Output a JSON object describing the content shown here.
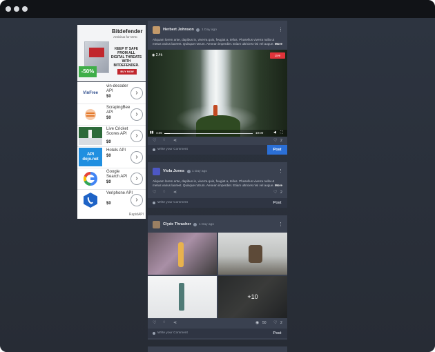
{
  "ads": {
    "banner": {
      "brand": "Bitdefender",
      "subtitle": "Antivirus for MAC",
      "tagline": "KEEP IT SAFE FROM ALL DIGITAL THREATS WITH BITDEFENDER.",
      "discount": "-50%",
      "cta": "BUY NOW"
    },
    "api_list": [
      {
        "name": "vin-decoder API",
        "price": "$0",
        "logo": "vinfree"
      },
      {
        "name": "ScrapingBee API",
        "price": "$0",
        "logo": "bee"
      },
      {
        "name": "Live Cricket Scores API",
        "price": "$0",
        "logo": "cricket"
      },
      {
        "name": "Hotels API",
        "price": "$0",
        "logo": "apidojo"
      },
      {
        "name": "Google Search API",
        "price": "$0",
        "logo": "google"
      },
      {
        "name": "Veriphone API",
        "price": "$0",
        "logo": "veriphone"
      }
    ],
    "footer": "RapidAPI",
    "logo_texts": {
      "vinfree": "VinFree",
      "apidojo": "API dojo.net"
    }
  },
  "posts": [
    {
      "author": "Herbert Johnson",
      "time": "1 Day ago",
      "text": "Aliquam lorem ante, dapibus in, viverra quis, feugiat a, tellus. Phasellus viverra nulla ut metus varius laoreet. Quisque rutrum. Aenean imperdiet. Etiam ultricies nisi vel augue.",
      "more": "More",
      "video": {
        "views": "2.4k",
        "live": "Live",
        "elapsed": "4:45",
        "duration": "10:00"
      },
      "likes": "2",
      "comment_placeholder": "Write your Comment",
      "post_label": "Post"
    },
    {
      "author": "Viola Jones",
      "time": "1 Day ago",
      "text": "Aliquam lorem ante, dapibus in, viverra quis, feugiat a, tellus. Phasellus viverra nulla ut metus varius laoreet. Quisque rutrum. Aenean imperdiet. Etiam ultricies nisi vel augue.",
      "more": "More",
      "likes": "2",
      "comment_placeholder": "Write your Comment",
      "post_label": "Post"
    },
    {
      "author": "Clyde Thrasher",
      "time": "1 Day ago",
      "extra_photos": "+10",
      "views": "50",
      "likes": "2",
      "comment_placeholder": "Write your Comment",
      "post_label": "Post"
    }
  ],
  "colors": {
    "accent": "#2b6fd6",
    "live": "#e0343a",
    "card": "#3a4150",
    "background": "#2a2f39"
  }
}
